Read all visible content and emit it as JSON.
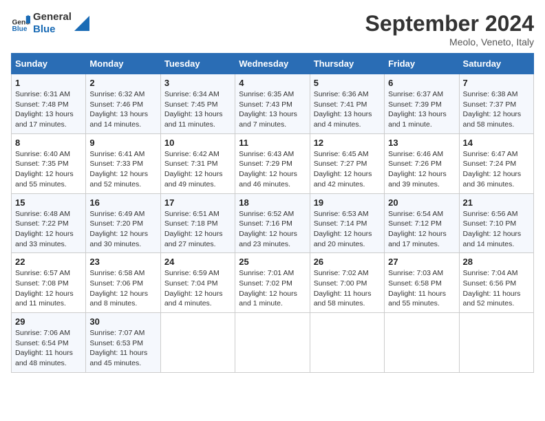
{
  "logo": {
    "line1": "General",
    "line2": "Blue"
  },
  "title": "September 2024",
  "location": "Meolo, Veneto, Italy",
  "days_header": [
    "Sunday",
    "Monday",
    "Tuesday",
    "Wednesday",
    "Thursday",
    "Friday",
    "Saturday"
  ],
  "weeks": [
    [
      {
        "day": "1",
        "info": "Sunrise: 6:31 AM\nSunset: 7:48 PM\nDaylight: 13 hours\nand 17 minutes."
      },
      {
        "day": "2",
        "info": "Sunrise: 6:32 AM\nSunset: 7:46 PM\nDaylight: 13 hours\nand 14 minutes."
      },
      {
        "day": "3",
        "info": "Sunrise: 6:34 AM\nSunset: 7:45 PM\nDaylight: 13 hours\nand 11 minutes."
      },
      {
        "day": "4",
        "info": "Sunrise: 6:35 AM\nSunset: 7:43 PM\nDaylight: 13 hours\nand 7 minutes."
      },
      {
        "day": "5",
        "info": "Sunrise: 6:36 AM\nSunset: 7:41 PM\nDaylight: 13 hours\nand 4 minutes."
      },
      {
        "day": "6",
        "info": "Sunrise: 6:37 AM\nSunset: 7:39 PM\nDaylight: 13 hours\nand 1 minute."
      },
      {
        "day": "7",
        "info": "Sunrise: 6:38 AM\nSunset: 7:37 PM\nDaylight: 12 hours\nand 58 minutes."
      }
    ],
    [
      {
        "day": "8",
        "info": "Sunrise: 6:40 AM\nSunset: 7:35 PM\nDaylight: 12 hours\nand 55 minutes."
      },
      {
        "day": "9",
        "info": "Sunrise: 6:41 AM\nSunset: 7:33 PM\nDaylight: 12 hours\nand 52 minutes."
      },
      {
        "day": "10",
        "info": "Sunrise: 6:42 AM\nSunset: 7:31 PM\nDaylight: 12 hours\nand 49 minutes."
      },
      {
        "day": "11",
        "info": "Sunrise: 6:43 AM\nSunset: 7:29 PM\nDaylight: 12 hours\nand 46 minutes."
      },
      {
        "day": "12",
        "info": "Sunrise: 6:45 AM\nSunset: 7:27 PM\nDaylight: 12 hours\nand 42 minutes."
      },
      {
        "day": "13",
        "info": "Sunrise: 6:46 AM\nSunset: 7:26 PM\nDaylight: 12 hours\nand 39 minutes."
      },
      {
        "day": "14",
        "info": "Sunrise: 6:47 AM\nSunset: 7:24 PM\nDaylight: 12 hours\nand 36 minutes."
      }
    ],
    [
      {
        "day": "15",
        "info": "Sunrise: 6:48 AM\nSunset: 7:22 PM\nDaylight: 12 hours\nand 33 minutes."
      },
      {
        "day": "16",
        "info": "Sunrise: 6:49 AM\nSunset: 7:20 PM\nDaylight: 12 hours\nand 30 minutes."
      },
      {
        "day": "17",
        "info": "Sunrise: 6:51 AM\nSunset: 7:18 PM\nDaylight: 12 hours\nand 27 minutes."
      },
      {
        "day": "18",
        "info": "Sunrise: 6:52 AM\nSunset: 7:16 PM\nDaylight: 12 hours\nand 23 minutes."
      },
      {
        "day": "19",
        "info": "Sunrise: 6:53 AM\nSunset: 7:14 PM\nDaylight: 12 hours\nand 20 minutes."
      },
      {
        "day": "20",
        "info": "Sunrise: 6:54 AM\nSunset: 7:12 PM\nDaylight: 12 hours\nand 17 minutes."
      },
      {
        "day": "21",
        "info": "Sunrise: 6:56 AM\nSunset: 7:10 PM\nDaylight: 12 hours\nand 14 minutes."
      }
    ],
    [
      {
        "day": "22",
        "info": "Sunrise: 6:57 AM\nSunset: 7:08 PM\nDaylight: 12 hours\nand 11 minutes."
      },
      {
        "day": "23",
        "info": "Sunrise: 6:58 AM\nSunset: 7:06 PM\nDaylight: 12 hours\nand 8 minutes."
      },
      {
        "day": "24",
        "info": "Sunrise: 6:59 AM\nSunset: 7:04 PM\nDaylight: 12 hours\nand 4 minutes."
      },
      {
        "day": "25",
        "info": "Sunrise: 7:01 AM\nSunset: 7:02 PM\nDaylight: 12 hours\nand 1 minute."
      },
      {
        "day": "26",
        "info": "Sunrise: 7:02 AM\nSunset: 7:00 PM\nDaylight: 11 hours\nand 58 minutes."
      },
      {
        "day": "27",
        "info": "Sunrise: 7:03 AM\nSunset: 6:58 PM\nDaylight: 11 hours\nand 55 minutes."
      },
      {
        "day": "28",
        "info": "Sunrise: 7:04 AM\nSunset: 6:56 PM\nDaylight: 11 hours\nand 52 minutes."
      }
    ],
    [
      {
        "day": "29",
        "info": "Sunrise: 7:06 AM\nSunset: 6:54 PM\nDaylight: 11 hours\nand 48 minutes."
      },
      {
        "day": "30",
        "info": "Sunrise: 7:07 AM\nSunset: 6:53 PM\nDaylight: 11 hours\nand 45 minutes."
      },
      {
        "day": "",
        "info": ""
      },
      {
        "day": "",
        "info": ""
      },
      {
        "day": "",
        "info": ""
      },
      {
        "day": "",
        "info": ""
      },
      {
        "day": "",
        "info": ""
      }
    ]
  ]
}
